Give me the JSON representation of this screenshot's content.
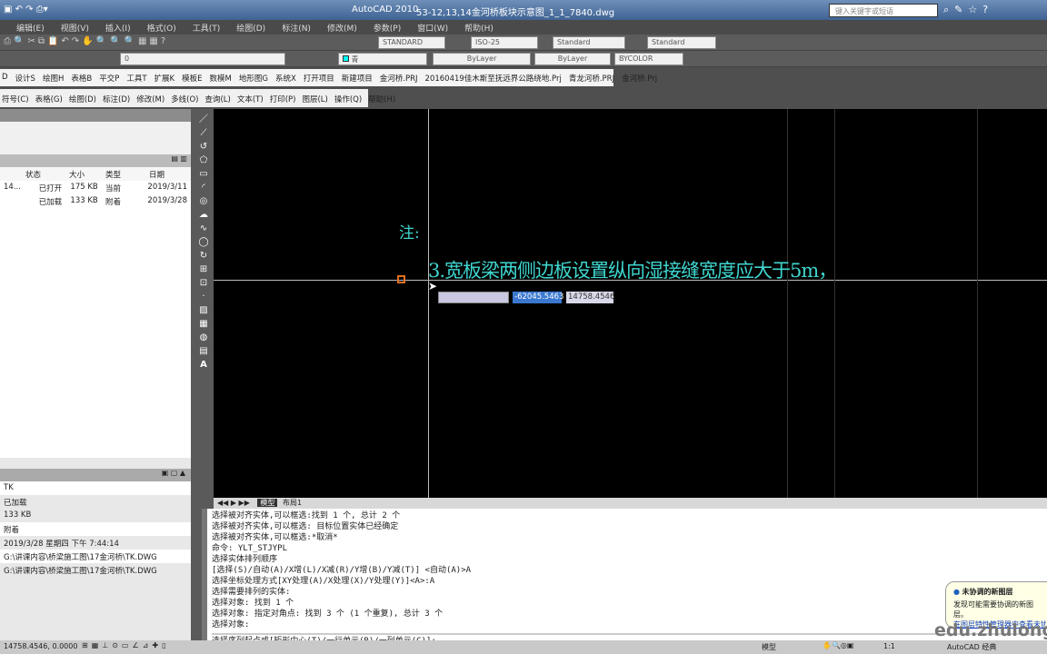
{
  "title_bar": {
    "app": "AutoCAD 2010",
    "file": "53-12,13,14金河桥板块示意图_1_1_7840.dwg",
    "search_placeholder": "键入关键字或短语"
  },
  "menu": [
    "编辑(E)",
    "视图(V)",
    "插入(I)",
    "格式(O)",
    "工具(T)",
    "绘图(D)",
    "标注(N)",
    "修改(M)",
    "参数(P)",
    "窗口(W)",
    "帮助(H)"
  ],
  "toolbar": {
    "text_style": "STANDARD",
    "dim_style": "ISO-25",
    "table_style": "Standard",
    "mleader_style": "Standard",
    "layer": "0",
    "color": "青",
    "linetype": "ByLayer",
    "lineweight": "ByLayer",
    "plotstyle": "BYCOLOR"
  },
  "custom_menu": [
    "D",
    "设计S",
    "绘图H",
    "表格B",
    "平交P",
    "工具T",
    "扩展K",
    "模板E",
    "数模M",
    "地形图G",
    "系统X",
    "打开项目",
    "新建项目",
    "金河桥.PRJ",
    "20160419佳木斯至抚远界公路绕地.Prj",
    "青龙河桥.PRJ",
    "金河桥.Prj"
  ],
  "custom_menu2": [
    "符号(C)",
    "表格(G)",
    "绘图(D)",
    "标注(D)",
    "修改(M)",
    "多线(O)",
    "查询(L)",
    "文本(T)",
    "打印(P)",
    "图层(L)",
    "操作(Q)",
    "帮助(H)"
  ],
  "xref": {
    "columns": [
      "状态",
      "大小",
      "类型",
      "日期"
    ],
    "rows": [
      {
        "name": "14...",
        "status": "已打开",
        "size": "175 KB",
        "type": "当前",
        "date": "2019/3/11"
      },
      {
        "name": "",
        "status": "已加载",
        "size": "133 KB",
        "type": "附着",
        "date": "2019/3/28"
      }
    ]
  },
  "details": [
    "TK",
    "已加载",
    "133 KB",
    "附着",
    "2019/3/28 星期四 下午 7:44:14",
    "G:\\讲课内容\\桥梁施工图\\17金河桥\\TK.DWG",
    "G:\\讲课内容\\桥梁施工图\\17金河桥\\TK.DWG"
  ],
  "drawing": {
    "note": "注:",
    "text": "3.宽板梁两侧边板设置纵向湿接缝宽度应大于5m，",
    "text_color": "#3fd6cf",
    "x_input": "-62045.5463",
    "y_input": "14758.4546"
  },
  "layout_tabs": [
    "模型",
    "布局1"
  ],
  "command_history": [
    "选择被对齐实体,可以框选:找到 1 个, 总计 2 个",
    "选择被对齐实体,可以框选: 目标位置实体已经确定",
    "选择被对齐实体,可以框选:*取消*",
    "命令: YLT_STJYPL",
    "选择实体排列顺序",
    "[选择(S)/自动(A)/X增(L)/X减(R)/Y增(B)/Y减(T)] <自动(A)>A",
    "选择坐标处理方式[XY处理(A)/X处理(X)/Y处理(Y)]<A>:A",
    "选择需要排列的实体:",
    "选择对象: 找到 1 个",
    "选择对象: 指定对角点: 找到 3 个 (1 个重复), 总计 3 个",
    "选择对象:"
  ],
  "command_prompt": "选择序列起点或[矩形中心(T)/一行单元(R)/一列单元(C)]:",
  "status": {
    "coords": "14758.4546, 0.0000",
    "model": "模型",
    "scale": "1:1",
    "workspace": "AutoCAD 经典"
  },
  "notification": {
    "title": "未协调的新图层",
    "body": "发现可能需要协调的新图层。",
    "link": "在图层特性管理器中查看未协"
  },
  "watermark": "edu.zhulong"
}
